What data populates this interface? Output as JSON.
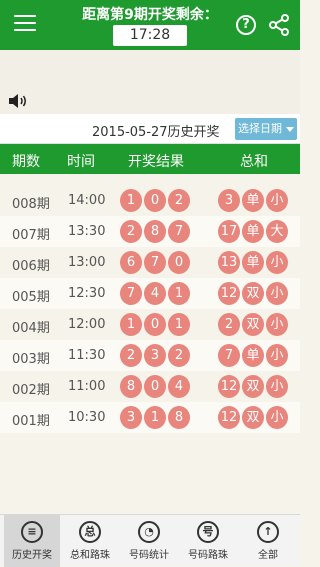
{
  "header": {
    "title": "距离第9期开奖剩余：",
    "timer": "17:28"
  },
  "datebar": {
    "label": "2015-05-27历史开奖",
    "select_label": "选择日期"
  },
  "table": {
    "headers": [
      "期数",
      "时间",
      "开奖结果",
      "总和"
    ],
    "rows": [
      {
        "period": "008期",
        "time": "14:00",
        "balls": [
          "1",
          "0",
          "2"
        ],
        "sum": "3",
        "bs": "单",
        "oe": "小"
      },
      {
        "period": "007期",
        "time": "13:30",
        "balls": [
          "2",
          "8",
          "7"
        ],
        "sum": "17",
        "bs": "单",
        "oe": "大"
      },
      {
        "period": "006期",
        "time": "13:00",
        "balls": [
          "6",
          "7",
          "0"
        ],
        "sum": "13",
        "bs": "单",
        "oe": "小"
      },
      {
        "period": "005期",
        "time": "12:30",
        "balls": [
          "7",
          "4",
          "1"
        ],
        "sum": "12",
        "bs": "双",
        "oe": "小"
      },
      {
        "period": "004期",
        "time": "12:00",
        "balls": [
          "1",
          "0",
          "1"
        ],
        "sum": "2",
        "bs": "双",
        "oe": "小"
      },
      {
        "period": "003期",
        "time": "11:30",
        "balls": [
          "2",
          "3",
          "2"
        ],
        "sum": "7",
        "bs": "单",
        "oe": "小"
      },
      {
        "period": "002期",
        "time": "11:00",
        "balls": [
          "8",
          "0",
          "4"
        ],
        "sum": "12",
        "bs": "双",
        "oe": "小"
      },
      {
        "period": "001期",
        "time": "10:30",
        "balls": [
          "3",
          "1",
          "8"
        ],
        "sum": "12",
        "bs": "双",
        "oe": "小"
      }
    ]
  },
  "tabs": [
    {
      "label": "历史开奖",
      "icon": "list-icon",
      "glyph": "≡"
    },
    {
      "label": "总和路珠",
      "icon": "sum-trend-icon",
      "glyph": "总"
    },
    {
      "label": "号码统计",
      "icon": "pie-chart-icon",
      "glyph": "◔"
    },
    {
      "label": "号码路珠",
      "icon": "number-trend-icon",
      "glyph": "号"
    },
    {
      "label": "全部",
      "icon": "upload-icon",
      "glyph": "↑"
    }
  ],
  "colors": {
    "brand_green": "#1e9a2e",
    "ball_red": "#e8857d",
    "select_blue": "#6fb8d8"
  }
}
